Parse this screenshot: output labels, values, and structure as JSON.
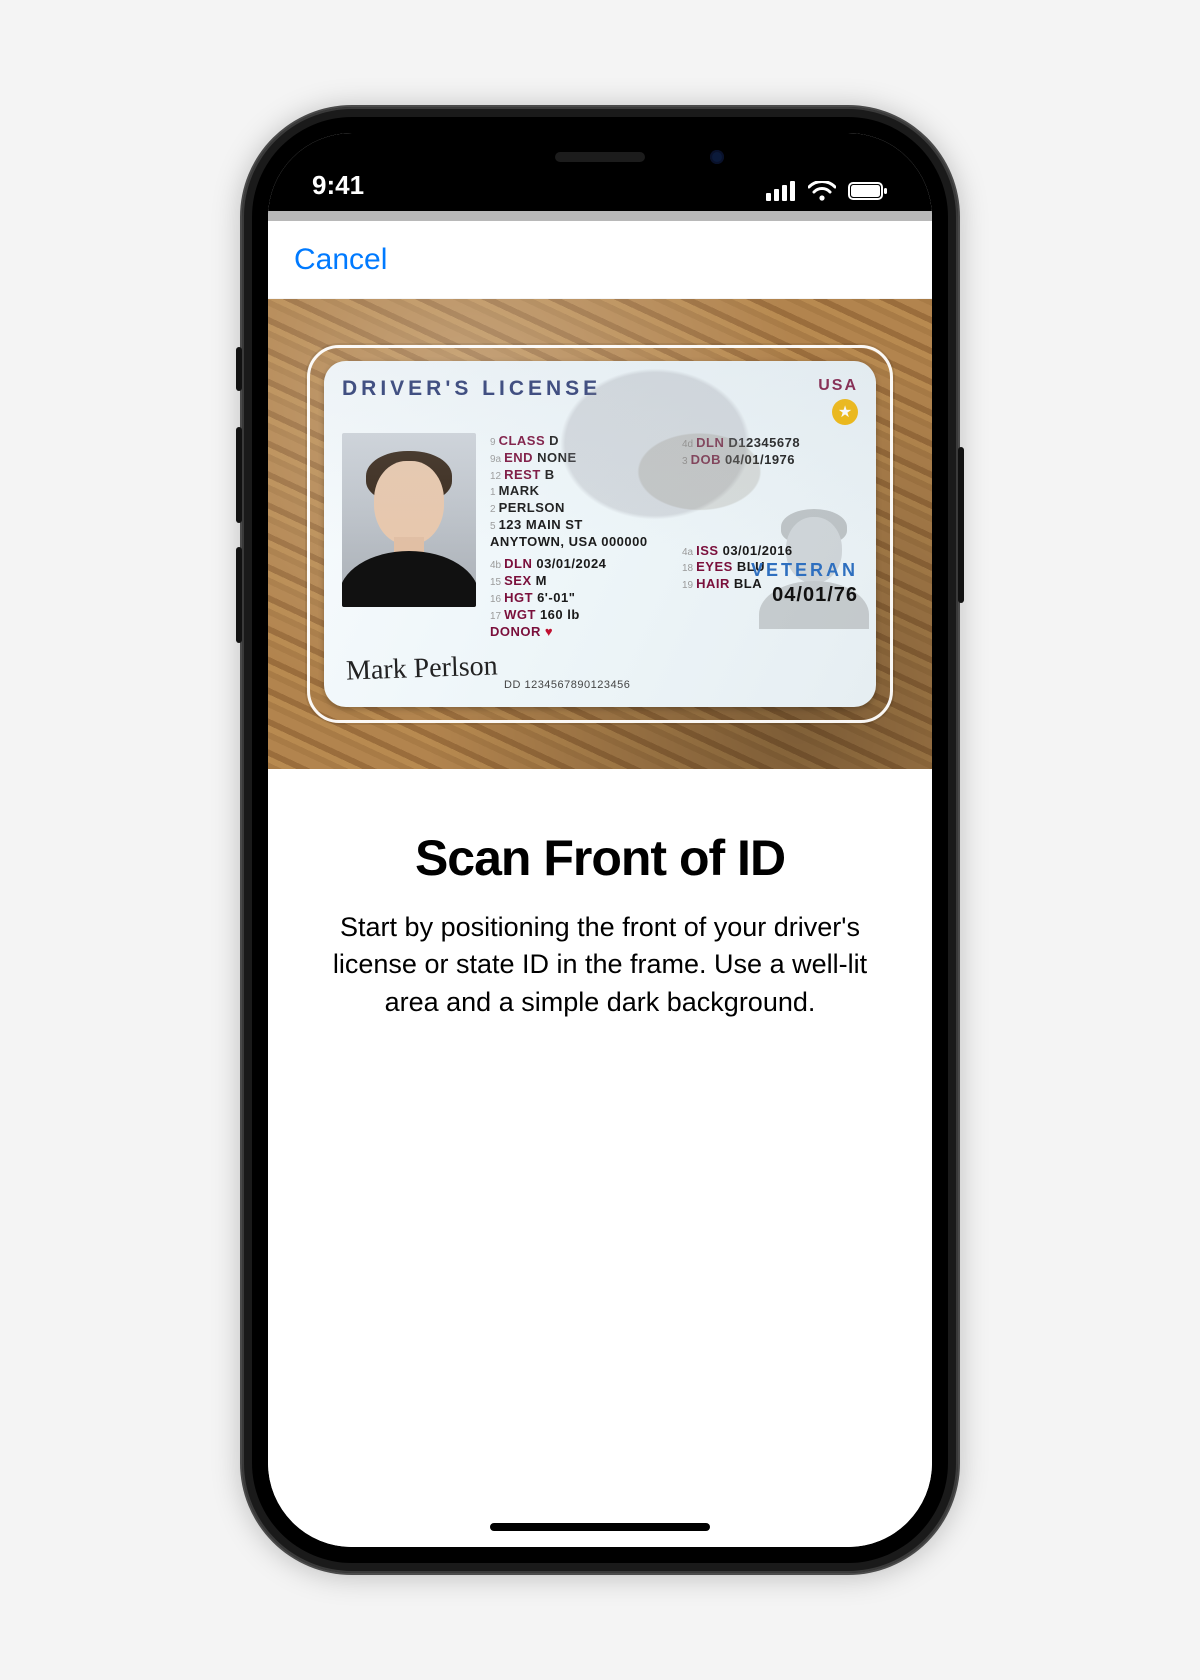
{
  "statusbar": {
    "time": "9:41"
  },
  "nav": {
    "cancel_label": "Cancel"
  },
  "instructions": {
    "title": "Scan Front of ID",
    "body": "Start by positioning the front of your driver's license or state ID in the frame. Use a well-lit area and a simple dark background."
  },
  "id_card": {
    "title": "DRIVER'S LICENSE",
    "country": "USA",
    "signature": "Mark Perlson",
    "dd_label": "DD",
    "dd_value": "1234567890123456",
    "veteran_label": "VETERAN",
    "dob_large": "04/01/76",
    "donor_label": "DONOR",
    "fields": {
      "class": {
        "num": "9",
        "key": "CLASS",
        "val": "D"
      },
      "end": {
        "num": "9a",
        "key": "END",
        "val": "NONE"
      },
      "rest": {
        "num": "12",
        "key": "REST",
        "val": "B"
      },
      "first": {
        "num": "1",
        "key": "",
        "val": "MARK"
      },
      "last": {
        "num": "2",
        "key": "",
        "val": "PERLSON"
      },
      "addr1": {
        "num": "5",
        "key": "",
        "val": "123 MAIN ST"
      },
      "addr2": {
        "num": "",
        "key": "",
        "val": "ANYTOWN, USA 000000"
      },
      "dln": {
        "num": "4b",
        "key": "DLN",
        "val": "03/01/2024"
      },
      "sex": {
        "num": "15",
        "key": "SEX",
        "val": "M"
      },
      "hgt": {
        "num": "16",
        "key": "HGT",
        "val": "6'-01\""
      },
      "wgt": {
        "num": "17",
        "key": "WGT",
        "val": "160 lb"
      },
      "dln2": {
        "num": "4d",
        "key": "DLN",
        "val": "D12345678"
      },
      "dob": {
        "num": "3",
        "key": "DOB",
        "val": "04/01/1976"
      },
      "iss": {
        "num": "4a",
        "key": "ISS",
        "val": "03/01/2016"
      },
      "eyes": {
        "num": "18",
        "key": "EYES",
        "val": "BLU"
      },
      "hair": {
        "num": "19",
        "key": "HAIR",
        "val": "BLA"
      }
    }
  }
}
